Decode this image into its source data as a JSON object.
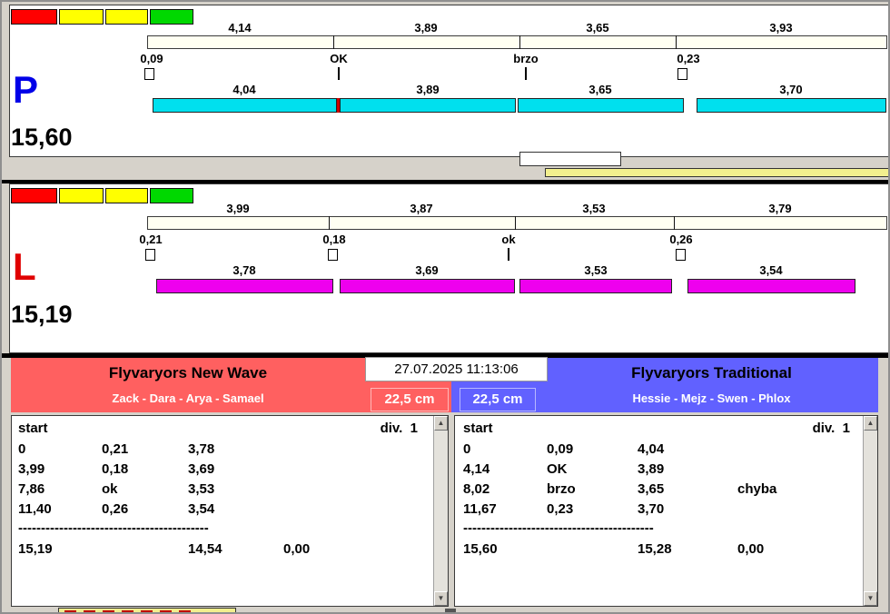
{
  "datetime": "27.07.2025 11:13:06",
  "icons": {
    "scroll_up": "▲",
    "scroll_down": "▼"
  },
  "separator_dashes": "------------------------------------------",
  "panels": {
    "p": {
      "letter": "P",
      "total": "15,60",
      "top_values": [
        "4,14",
        "3,89",
        "3,65",
        "3,93"
      ],
      "markers": [
        "0,09",
        "OK",
        "brzo",
        "0,23"
      ],
      "bottom_values": [
        "4,04",
        "3,89",
        "3,65",
        "3,70"
      ]
    },
    "l": {
      "letter": "L",
      "total": "15,19",
      "top_values": [
        "3,99",
        "3,87",
        "3,53",
        "3,79"
      ],
      "markers": [
        "0,21",
        "0,18",
        "ok",
        "0,26"
      ],
      "bottom_values": [
        "3,78",
        "3,69",
        "3,53",
        "3,54"
      ]
    }
  },
  "teams": {
    "left": {
      "name": "Flyvaryors New Wave",
      "members": "Zack - Dara - Arya - Samael",
      "distance": "22,5 cm",
      "header_start": "start",
      "header_div": "div.  1",
      "rows": [
        [
          "0",
          "0,21",
          "3,78",
          ""
        ],
        [
          "3,99",
          "0,18",
          "3,69",
          ""
        ],
        [
          "7,86",
          "ok",
          "3,53",
          ""
        ],
        [
          "11,40",
          "0,26",
          "3,54",
          ""
        ]
      ],
      "total_row": [
        "15,19",
        "",
        "14,54",
        "0,00"
      ]
    },
    "right": {
      "name": "Flyvaryors Traditional",
      "members": "Hessie - Mejz - Swen - Phlox",
      "distance": "22,5 cm",
      "header_start": "start",
      "header_div": "div.  1",
      "rows": [
        [
          "0",
          "0,09",
          "4,04",
          ""
        ],
        [
          "4,14",
          "OK",
          "3,89",
          ""
        ],
        [
          "8,02",
          "brzo",
          "3,65",
          "chyba"
        ],
        [
          "11,67",
          "0,23",
          "3,70",
          ""
        ]
      ],
      "total_row": [
        "15,60",
        "",
        "15,28",
        "0,00"
      ]
    }
  },
  "colors": {
    "cyan_bar": "#00e0ee",
    "magenta_bar": "#ee00ee",
    "quality_blocks": [
      "#ff0000",
      "#ffff00",
      "#ffff00",
      "#00d800"
    ],
    "ruler_bar": "#fffff2",
    "team_left_bg": "#ff6060",
    "team_right_bg": "#6161ff",
    "letter_p": "#0000e8",
    "letter_l": "#e00000",
    "mid_yellow": "#f2ef8e"
  }
}
